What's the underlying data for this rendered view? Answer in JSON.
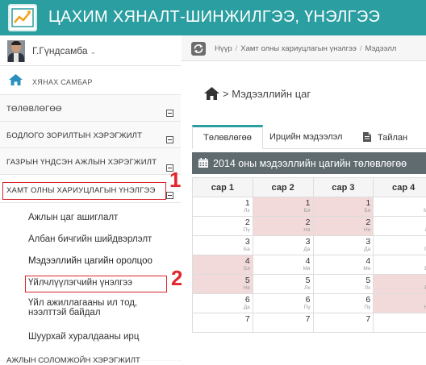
{
  "header": {
    "title": "ЦАХИМ ХЯНАЛТ-ШИНЖИЛГЭЭ, ҮНЭЛГЭЭ",
    "logo_icon": "chart-trend-icon"
  },
  "user": {
    "name": "Г.Гүндсамба"
  },
  "sidebar": {
    "dashboard_label": "ХЯНАХ САМБАР",
    "items": [
      {
        "label": "ТӨЛӨВЛӨГӨӨ"
      },
      {
        "label": "БОДЛОГО ЗОРИЛТЫН ХЭРЭГЖИЛТ"
      },
      {
        "label": "ГАЗРЫН ҮНДСЭН АЖЛЫН ХЭРЭГЖИЛТ"
      },
      {
        "label": "ХАМТ ОЛНЫ ХАРИУЦЛАГЫН ҮНЭЛГЭЭ",
        "marker": "1"
      }
    ],
    "submenu": [
      {
        "label": "Ажлын цаг ашиглалт"
      },
      {
        "label": "Албан бичгийн шийдвэрлэлт"
      },
      {
        "label": "Мэдээллийн цагийн оролцоо",
        "marker": "2"
      },
      {
        "label": "Үйлчлүүлэгчийн үнэлгээ"
      },
      {
        "label": "Үйл ажиллагааны ил тод,",
        "label2": "нээлттэй байдал"
      },
      {
        "label": "Шуурхай хуралдааны ирц"
      }
    ],
    "cutoff_label": "АЖЛЫН СОЛОМЖОЙН ХЭРЭГЖИЛТ"
  },
  "breadcrumb": [
    "Нүүр",
    "Хамт олны хариуцлагын үнэлгээ",
    "Мэдээлл"
  ],
  "page": {
    "title": "> Мэдээллийн цаг"
  },
  "tabs": [
    {
      "label": "Төлөвлөгөө",
      "active": true
    },
    {
      "label": "Ирцийн мэдээлэл",
      "active": false
    },
    {
      "label": "Тайлан",
      "active": false
    }
  ],
  "panel": {
    "title": "2014 оны мэдээллийн цагийн төлөвлөгөө"
  },
  "calendar": {
    "months": [
      "сар 1",
      "сар 2",
      "сар 3",
      "сар 4"
    ],
    "rows": [
      [
        {
          "d": "1",
          "w": "Лх",
          "hol": false
        },
        {
          "d": "1",
          "w": "Бя",
          "hol": true
        },
        {
          "d": "1",
          "w": "Бя",
          "hol": true
        },
        {
          "d": "1",
          "w": "Мя",
          "hol": false
        }
      ],
      [
        {
          "d": "2",
          "w": "Пү",
          "hol": false
        },
        {
          "d": "2",
          "w": "Ня",
          "hol": true
        },
        {
          "d": "2",
          "w": "Ня",
          "hol": true
        },
        {
          "d": "2",
          "w": "Лх",
          "hol": false
        }
      ],
      [
        {
          "d": "3",
          "w": "Ба",
          "hol": false
        },
        {
          "d": "3",
          "w": "Да",
          "hol": false
        },
        {
          "d": "3",
          "w": "Да",
          "hol": false
        },
        {
          "d": "3",
          "w": "Пү",
          "hol": false
        }
      ],
      [
        {
          "d": "4",
          "w": "Бя",
          "hol": true
        },
        {
          "d": "4",
          "w": "Мя",
          "hol": false
        },
        {
          "d": "4",
          "w": "Мя",
          "hol": false
        },
        {
          "d": "4",
          "w": "Ба",
          "hol": false
        }
      ],
      [
        {
          "d": "5",
          "w": "Ня",
          "hol": true
        },
        {
          "d": "5",
          "w": "Лх",
          "hol": false
        },
        {
          "d": "5",
          "w": "Лх",
          "hol": false
        },
        {
          "d": "5",
          "w": "Бя",
          "hol": true
        }
      ],
      [
        {
          "d": "6",
          "w": "Да",
          "hol": false
        },
        {
          "d": "6",
          "w": "Пү",
          "hol": false
        },
        {
          "d": "6",
          "w": "Пү",
          "hol": false
        },
        {
          "d": "6",
          "w": "Ня",
          "hol": true
        }
      ],
      [
        {
          "d": "7",
          "w": "",
          "hol": false
        },
        {
          "d": "7",
          "w": "",
          "hol": false
        },
        {
          "d": "7",
          "w": "",
          "hol": false
        },
        {
          "d": "7",
          "w": "",
          "hol": false
        }
      ]
    ]
  }
}
